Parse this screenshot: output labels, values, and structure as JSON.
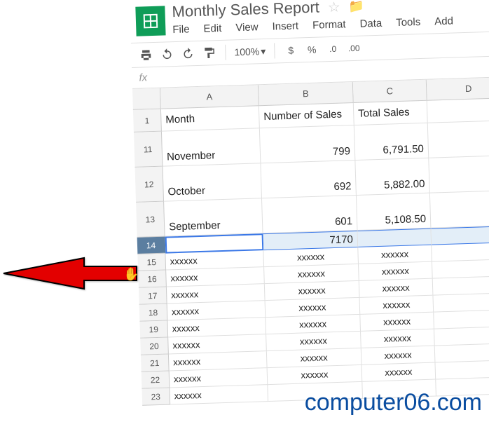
{
  "header": {
    "doc_title": "Monthly Sales Report",
    "menus": [
      "File",
      "Edit",
      "View",
      "Insert",
      "Format",
      "Data",
      "Tools",
      "Add"
    ]
  },
  "toolbar": {
    "zoom": "100%",
    "currency": "$",
    "percent": "%",
    "dec_dec": ".0",
    "inc_dec": ".00"
  },
  "formula_bar": {
    "label": "fx"
  },
  "columns": [
    "A",
    "B",
    "C",
    "D"
  ],
  "rows": [
    {
      "num": "1",
      "h": "h1",
      "cells": [
        "Month",
        "Number of Sales",
        "Total Sales",
        ""
      ],
      "align": [
        "l",
        "l",
        "l",
        "l"
      ]
    },
    {
      "num": "11",
      "h": "tall",
      "cells": [
        "November",
        "799",
        "6,791.50",
        ""
      ],
      "align": [
        "l",
        "r",
        "r",
        "l"
      ]
    },
    {
      "num": "12",
      "h": "tall",
      "cells": [
        "October",
        "692",
        "5,882.00",
        ""
      ],
      "align": [
        "l",
        "r",
        "r",
        "l"
      ]
    },
    {
      "num": "13",
      "h": "tall",
      "cells": [
        "September",
        "601",
        "5,108.50",
        ""
      ],
      "align": [
        "l",
        "r",
        "r",
        "l"
      ]
    },
    {
      "num": "14",
      "h": "sel",
      "cells": [
        "",
        "7170",
        "",
        ""
      ],
      "align": [
        "l",
        "r",
        "l",
        "l"
      ]
    },
    {
      "num": "15",
      "h": "norm",
      "cells": [
        "xxxxxx",
        "xxxxxx",
        "xxxxxx",
        ""
      ],
      "align": [
        "l",
        "c",
        "c",
        "l"
      ]
    },
    {
      "num": "16",
      "h": "norm",
      "cells": [
        "xxxxxx",
        "xxxxxx",
        "xxxxxx",
        ""
      ],
      "align": [
        "l",
        "c",
        "c",
        "l"
      ]
    },
    {
      "num": "17",
      "h": "norm",
      "cells": [
        "xxxxxx",
        "xxxxxx",
        "xxxxxx",
        ""
      ],
      "align": [
        "l",
        "c",
        "c",
        "l"
      ]
    },
    {
      "num": "18",
      "h": "norm",
      "cells": [
        "xxxxxx",
        "xxxxxx",
        "xxxxxx",
        ""
      ],
      "align": [
        "l",
        "c",
        "c",
        "l"
      ]
    },
    {
      "num": "19",
      "h": "norm",
      "cells": [
        "xxxxxx",
        "xxxxxx",
        "xxxxxx",
        ""
      ],
      "align": [
        "l",
        "c",
        "c",
        "l"
      ]
    },
    {
      "num": "20",
      "h": "norm",
      "cells": [
        "xxxxxx",
        "xxxxxx",
        "xxxxxx",
        ""
      ],
      "align": [
        "l",
        "c",
        "c",
        "l"
      ]
    },
    {
      "num": "21",
      "h": "norm",
      "cells": [
        "xxxxxx",
        "xxxxxx",
        "xxxxxx",
        ""
      ],
      "align": [
        "l",
        "c",
        "c",
        "l"
      ]
    },
    {
      "num": "22",
      "h": "norm",
      "cells": [
        "xxxxxx",
        "xxxxxx",
        "xxxxxx",
        ""
      ],
      "align": [
        "l",
        "c",
        "c",
        "l"
      ]
    },
    {
      "num": "23",
      "h": "norm",
      "cells": [
        "xxxxxx",
        "",
        "",
        ""
      ],
      "align": [
        "l",
        "c",
        "c",
        "l"
      ]
    }
  ],
  "watermark": "computer06.com"
}
